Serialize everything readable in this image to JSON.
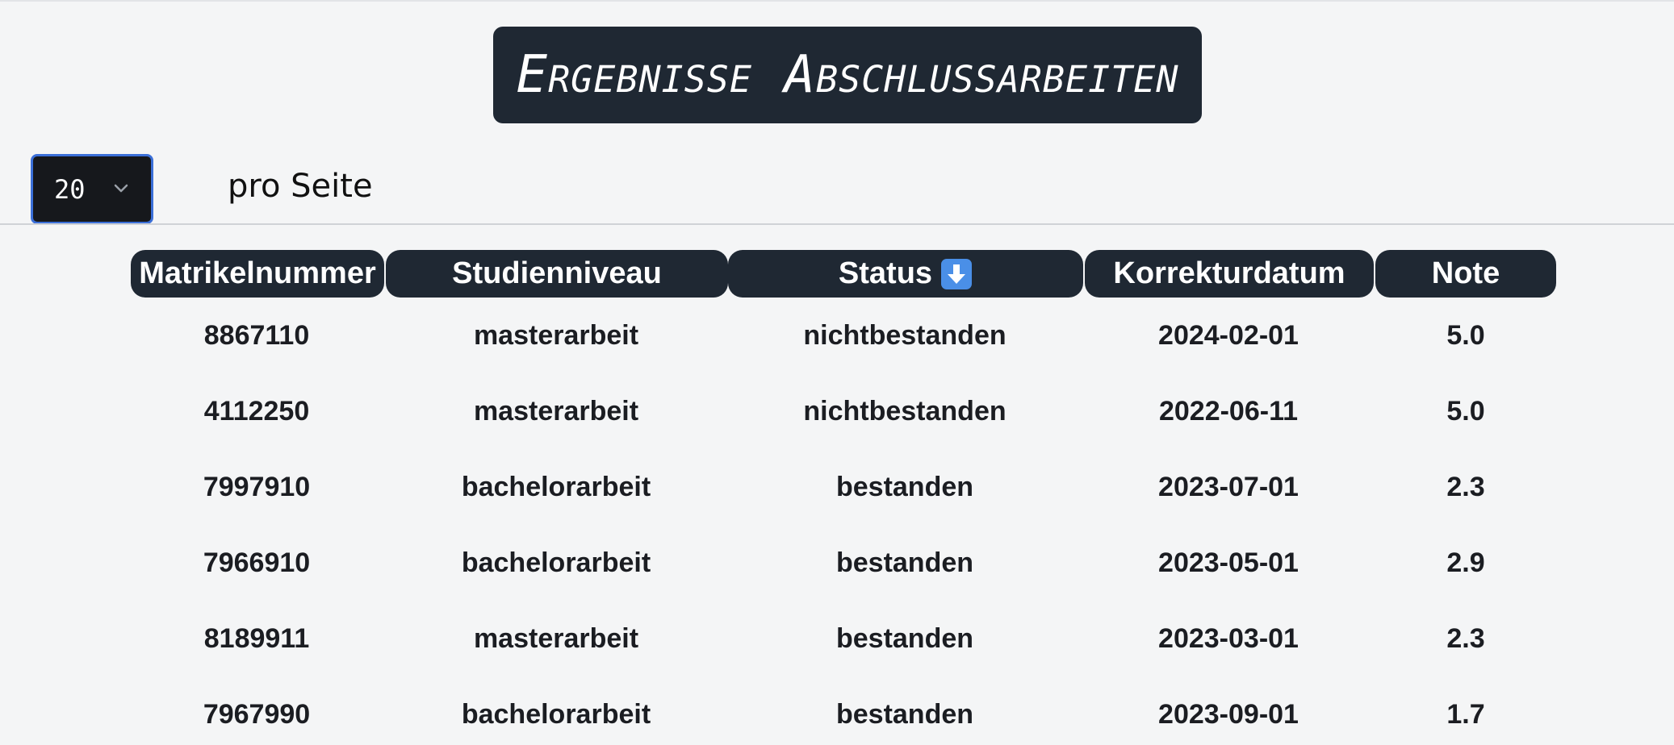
{
  "page": {
    "title": "Ergebnisse Abschlussarbeiten"
  },
  "pagination": {
    "per_page_value": "20",
    "per_page_label": "pro Seite"
  },
  "table": {
    "headers": [
      {
        "label": "Matrikelnummer",
        "sort_icon": ""
      },
      {
        "label": "Studienniveau",
        "sort_icon": ""
      },
      {
        "label": "Status",
        "sort_icon": "sort-descending-icon"
      },
      {
        "label": "Korrekturdatum",
        "sort_icon": ""
      },
      {
        "label": "Note",
        "sort_icon": ""
      }
    ],
    "rows": [
      [
        "8867110",
        "masterarbeit",
        "nichtbestanden",
        "2024-02-01",
        "5.0"
      ],
      [
        "4112250",
        "masterarbeit",
        "nichtbestanden",
        "2022-06-11",
        "5.0"
      ],
      [
        "7997910",
        "bachelorarbeit",
        "bestanden",
        "2023-07-01",
        "2.3"
      ],
      [
        "7966910",
        "bachelorarbeit",
        "bestanden",
        "2023-05-01",
        "2.9"
      ],
      [
        "8189911",
        "masterarbeit",
        "bestanden",
        "2023-03-01",
        "2.3"
      ],
      [
        "7967990",
        "bachelorarbeit",
        "bestanden",
        "2023-09-01",
        "1.7"
      ]
    ]
  },
  "colors": {
    "header_bg": "#1f2833",
    "select_border": "#3b6fd8",
    "sort_icon_bg": "#4a8fe7"
  }
}
